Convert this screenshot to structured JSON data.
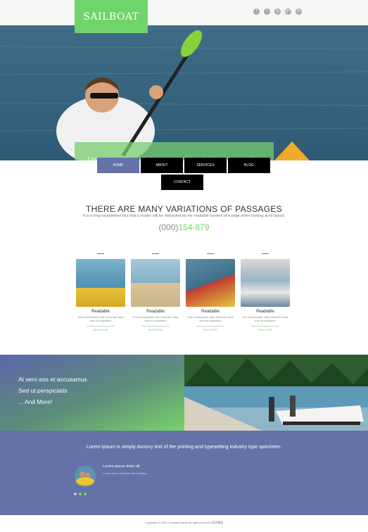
{
  "header": {
    "logo": "SAILBOAT",
    "social": [
      "f",
      "t",
      "p",
      "g+",
      "in"
    ]
  },
  "hero": {
    "caption": "Lorem Ipsum is simply dummy text of the printing and typesetting industry. Lorem Ipsum has been the industry's standard"
  },
  "nav": {
    "items": [
      "HOME",
      "ABOUT",
      "SERVICES",
      "BLOG",
      "CONTACT"
    ]
  },
  "intro": {
    "title": "THERE ARE MANY VARIATIONS OF PASSAGES",
    "subtitle": "It is a long established fact that a reader will be distracted by the readable content of a page when looking at its layout.",
    "phone_code": "(000)",
    "phone_num": "154-879"
  },
  "cards": [
    {
      "title": "Readable",
      "desc": "Sed ut perspiciatis unde omnis iste natus error sit voluptatem",
      "more": "READ MORE"
    },
    {
      "title": "Readable",
      "desc": "Sed ut perspiciatis unde omnis iste natus error sit voluptatem",
      "more": "READ MORE"
    },
    {
      "title": "Readable",
      "desc": "Sed ut perspiciatis unde omnis iste natus error sit voluptatem",
      "more": "READ MORE"
    },
    {
      "title": "Readable",
      "desc": "Sed ut perspiciatis unde omnis iste natus error sit voluptatem",
      "more": "READ MORE"
    }
  ],
  "band": {
    "lines": [
      "At vero eos et accusamus",
      "Sed ut perspiciatis",
      "... And More!"
    ]
  },
  "testimonial": {
    "quote": "Lorem Ipsum is simply dummy text of the printing and typesetting industry type specimen.",
    "name": "Lorem ipsum dolor sit",
    "role": "Lorem ipsum has been the industry"
  },
  "footer": {
    "copyright": "Copyright © 2016 Company Name All rights reserved.网页模板"
  },
  "colors": {
    "accent": "#6fd46a",
    "blue": "#6472a8",
    "nav": "#000000"
  }
}
